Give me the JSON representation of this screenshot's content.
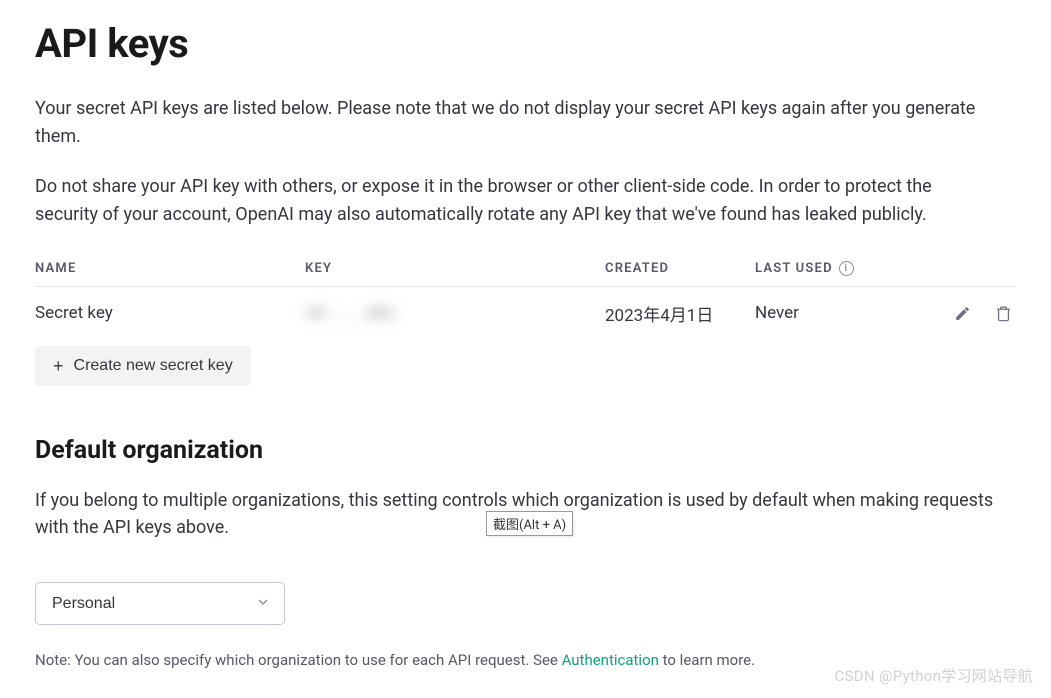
{
  "header": {
    "title": "API keys"
  },
  "descriptions": {
    "p1": "Your secret API keys are listed below. Please note that we do not display your secret API keys again after you generate them.",
    "p2": "Do not share your API key with others, or expose it in the browser or other client-side code. In order to protect the security of your account, OpenAI may also automatically rotate any API key that we've found has leaked publicly."
  },
  "table": {
    "headers": {
      "name": "NAME",
      "key": "KEY",
      "created": "CREATED",
      "last_used": "LAST USED"
    },
    "rows": [
      {
        "name": "Secret key",
        "key_masked": "sk-...abc",
        "created": "2023年4月1日",
        "last_used": "Never"
      }
    ]
  },
  "actions": {
    "create_label": "Create new secret key"
  },
  "org_section": {
    "title": "Default organization",
    "description": "If you belong to multiple organizations, this setting controls which organization is used by default when making requests with the API keys above.",
    "selected": "Personal",
    "note_prefix": "Note: You can also specify which organization to use for each API request. See ",
    "note_link": "Authentication",
    "note_suffix": " to learn more."
  },
  "tooltip": {
    "text": "截图(Alt + A)"
  },
  "watermark": {
    "text": "CSDN @Python学习网站导航"
  }
}
